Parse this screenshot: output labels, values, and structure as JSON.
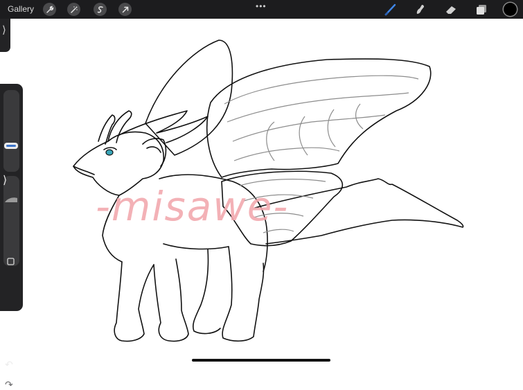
{
  "toolbar": {
    "gallery_label": "Gallery",
    "more_label": "•••",
    "left_tools": [
      "wrench-icon",
      "magic-wand-icon",
      "selection-icon",
      "move-arrow-icon"
    ],
    "right_tools": [
      "brush-icon",
      "smudge-icon",
      "eraser-icon",
      "layers-icon"
    ],
    "active_tool": "brush-icon",
    "active_tool_color": "#3f86e8",
    "current_color": "#000000"
  },
  "sidebar": {
    "collapse_label": "⟩",
    "brush_size_level": 0.55,
    "undo_label": "↶",
    "redo_label": "↷"
  },
  "canvas": {
    "watermark_text": "-misawe-",
    "watermark_color": "#f2a9ae"
  }
}
